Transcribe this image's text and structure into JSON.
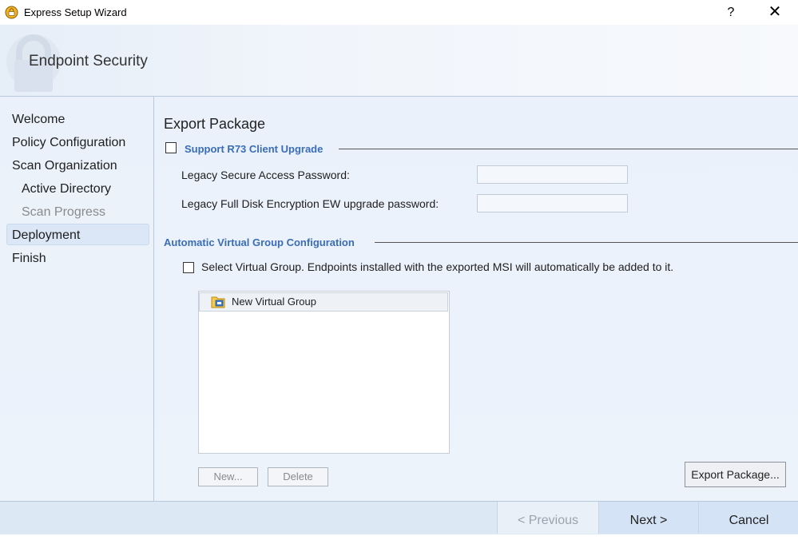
{
  "window": {
    "title": "Express Setup Wizard",
    "help_label": "?",
    "close_label": "✕"
  },
  "banner": {
    "product_name": "Endpoint Security"
  },
  "nav": {
    "items": [
      {
        "label": "Welcome",
        "state": "normal"
      },
      {
        "label": "Policy Configuration",
        "state": "normal"
      },
      {
        "label": "Scan Organization",
        "state": "normal"
      },
      {
        "label": "Active Directory",
        "state": "normal"
      },
      {
        "label": "Scan Progress",
        "state": "disabled"
      },
      {
        "label": "Deployment",
        "state": "selected"
      },
      {
        "label": "Finish",
        "state": "normal"
      }
    ]
  },
  "content": {
    "title": "Export Package",
    "support_section": {
      "label": "Support R73 Client Upgrade",
      "checked": false,
      "fields": [
        {
          "label": "Legacy Secure Access Password:",
          "value": ""
        },
        {
          "label": "Legacy Full Disk Encryption EW upgrade password:",
          "value": ""
        }
      ]
    },
    "virtual_group_section": {
      "label": "Automatic Virtual Group Configuration",
      "checkbox_label": "Select Virtual Group. Endpoints installed with the exported MSI will automatically be added to it.",
      "checked": false,
      "list_items": [
        "New Virtual Group"
      ],
      "new_label": "New...",
      "delete_label": "Delete"
    },
    "export_label": "Export Package..."
  },
  "footer": {
    "previous_label": "< Previous",
    "next_label": "Next >",
    "cancel_label": "Cancel"
  },
  "colors": {
    "accent": "#3a6db5",
    "nav_bg": "#eaf1fa",
    "footer_bg": "#dde8f5"
  }
}
